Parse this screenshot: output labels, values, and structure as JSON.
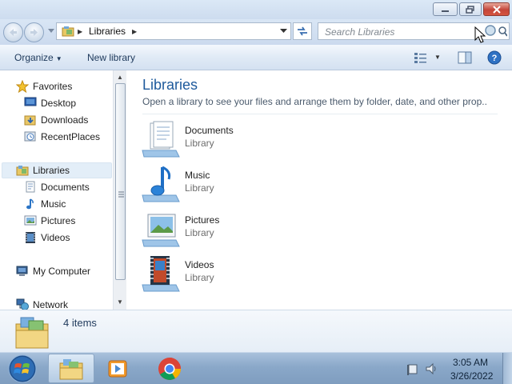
{
  "window": {
    "controls": {
      "minimize": "minimize-icon",
      "maximize": "restore-icon",
      "close": "close-icon"
    }
  },
  "address": {
    "path": "Libraries",
    "search_placeholder": "Search Libraries"
  },
  "toolbar": {
    "organize_label": "Organize",
    "new_library_label": "New library"
  },
  "nav": {
    "favorites": {
      "label": "Favorites",
      "items": [
        {
          "label": "Desktop"
        },
        {
          "label": "Downloads"
        },
        {
          "label": "RecentPlaces"
        }
      ]
    },
    "libraries": {
      "label": "Libraries",
      "items": [
        {
          "label": "Documents"
        },
        {
          "label": "Music"
        },
        {
          "label": "Pictures"
        },
        {
          "label": "Videos"
        }
      ]
    },
    "computer": {
      "label": "My Computer"
    },
    "network": {
      "label": "Network"
    }
  },
  "content": {
    "title": "Libraries",
    "subtitle": "Open a library to see your files and arrange them by folder, date, and other prop...",
    "libraries": [
      {
        "name": "Documents",
        "type": "Library"
      },
      {
        "name": "Music",
        "type": "Library"
      },
      {
        "name": "Pictures",
        "type": "Library"
      },
      {
        "name": "Videos",
        "type": "Library"
      }
    ]
  },
  "details": {
    "count": "4 items"
  },
  "taskbar": {
    "time": "3:05 AM",
    "date": "3/26/2022"
  },
  "colors": {
    "title_accent": "#1e5a9c",
    "selection": "#e3eef8",
    "close_button": "#c4453a"
  }
}
